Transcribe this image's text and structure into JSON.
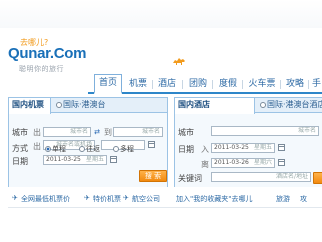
{
  "logo": {
    "slogan": "去哪儿?",
    "name": "Qunar.Com",
    "tagline": "聪明你的旅行"
  },
  "nav": {
    "items": [
      {
        "label": "首页"
      },
      {
        "label": "机票"
      },
      {
        "label": "酒店"
      },
      {
        "label": "团购"
      },
      {
        "label": "度假"
      },
      {
        "label": "火车票"
      },
      {
        "label": "攻略"
      },
      {
        "label": "手"
      }
    ]
  },
  "flight_panel": {
    "tabs": [
      {
        "label": "国内机票"
      },
      {
        "label": "国际·港澳台"
      }
    ],
    "from_label": "城市",
    "from_sub": "出",
    "from_placeholder": "城市名",
    "to_sub": "到",
    "to_placeholder": "城市名",
    "dest_label": "",
    "dest_sub": "出",
    "dest_placeholder": "城市名或机场",
    "type_label": "方式",
    "type_options": [
      "单程",
      "往返",
      "多程"
    ],
    "date_label": "日期",
    "date_value": "2011-03-25",
    "date_day": "星期五",
    "search_label": "搜 索"
  },
  "hotel_panel": {
    "tabs": [
      {
        "label": "国内酒店"
      },
      {
        "label": "国际·港澳台酒店"
      }
    ],
    "city_label": "城市",
    "city_placeholder": "城市名",
    "checkin_label": "日期",
    "checkin_sub": "入",
    "checkin_value": "2011-03-25",
    "checkin_day": "星期五",
    "checkout_sub": "离",
    "checkout_value": "2011-03-26",
    "checkout_day": "星期六",
    "keyword_label": "关键词",
    "keyword_placeholder": "酒店名/地址"
  },
  "bottom_links": [
    {
      "label": "全网最低机票价"
    },
    {
      "label": "特价机票"
    },
    {
      "label": "航空公司"
    },
    {
      "label": "加入\"我的收藏夹\"去哪儿"
    },
    {
      "label": "旅游"
    },
    {
      "label": "攻"
    }
  ],
  "colors": {
    "brand_blue": "#1a70b8",
    "accent_orange": "#f28a0f",
    "nav_border": "#2d86c9"
  }
}
